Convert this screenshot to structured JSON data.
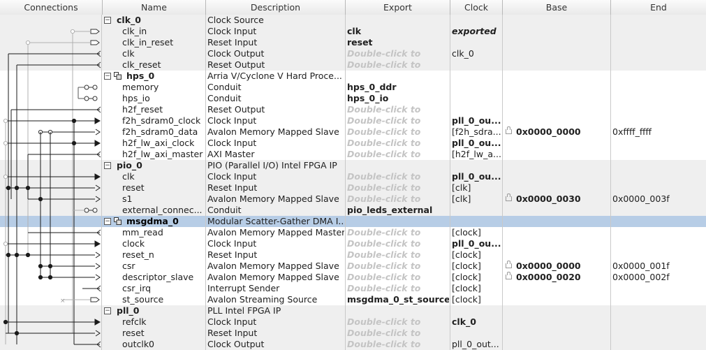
{
  "columns": [
    "Connections",
    "Name",
    "Description",
    "Export",
    "Clock",
    "Base",
    "End"
  ],
  "rows": [
    {
      "type": "component",
      "name": "clk_0",
      "desc": "Clock Source",
      "exp": "",
      "clk": "",
      "base": "",
      "end": ""
    },
    {
      "type": "port",
      "name": "clk_in",
      "desc": "Clock Input",
      "exp": "clk",
      "clk": "exported",
      "base": "",
      "end": ""
    },
    {
      "type": "port",
      "name": "clk_in_reset",
      "desc": "Reset Input",
      "exp": "reset",
      "clk": "",
      "base": "",
      "end": ""
    },
    {
      "type": "port",
      "name": "clk",
      "desc": "Clock Output",
      "exp": "Double-click to",
      "clk": "clk_0",
      "base": "",
      "end": ""
    },
    {
      "type": "port",
      "name": "clk_reset",
      "desc": "Reset Output",
      "exp": "Double-click to",
      "clk": "",
      "base": "",
      "end": ""
    },
    {
      "type": "component",
      "name": "hps_0",
      "desc": "Arria V/Cyclone V Hard Proce...",
      "exp": "",
      "clk": "",
      "base": "",
      "end": ""
    },
    {
      "type": "port",
      "name": "memory",
      "desc": "Conduit",
      "exp": "hps_0_ddr",
      "clk": "",
      "base": "",
      "end": ""
    },
    {
      "type": "port",
      "name": "hps_io",
      "desc": "Conduit",
      "exp": "hps_0_io",
      "clk": "",
      "base": "",
      "end": ""
    },
    {
      "type": "port",
      "name": "h2f_reset",
      "desc": "Reset Output",
      "exp": "Double-click to",
      "clk": "",
      "base": "",
      "end": ""
    },
    {
      "type": "port",
      "name": "f2h_sdram0_clock",
      "desc": "Clock Input",
      "exp": "Double-click to",
      "clk": "pll_0_ou...",
      "base": "",
      "end": ""
    },
    {
      "type": "port",
      "name": "f2h_sdram0_data",
      "desc": "Avalon Memory Mapped Slave",
      "exp": "Double-click to",
      "clk": "[f2h_sdra...",
      "base": "0x0000_0000",
      "end": "0xffff_ffff"
    },
    {
      "type": "port",
      "name": "h2f_lw_axi_clock",
      "desc": "Clock Input",
      "exp": "Double-click to",
      "clk": "pll_0_ou...",
      "base": "",
      "end": ""
    },
    {
      "type": "port",
      "name": "h2f_lw_axi_master",
      "desc": "AXI Master",
      "exp": "Double-click to",
      "clk": "[h2f_lw_a...",
      "base": "",
      "end": ""
    },
    {
      "type": "component",
      "name": "pio_0",
      "desc": "PIO (Parallel I/O) Intel FPGA IP",
      "exp": "",
      "clk": "",
      "base": "",
      "end": ""
    },
    {
      "type": "port",
      "name": "clk",
      "desc": "Clock Input",
      "exp": "Double-click to",
      "clk": "pll_0_ou...",
      "base": "",
      "end": ""
    },
    {
      "type": "port",
      "name": "reset",
      "desc": "Reset Input",
      "exp": "Double-click to",
      "clk": "[clk]",
      "base": "",
      "end": ""
    },
    {
      "type": "port",
      "name": "s1",
      "desc": "Avalon Memory Mapped Slave",
      "exp": "Double-click to",
      "clk": "[clk]",
      "base": "0x0000_0030",
      "end": "0x0000_003f"
    },
    {
      "type": "port",
      "name": "external_connec...",
      "desc": "Conduit",
      "exp": "pio_leds_external",
      "clk": "",
      "base": "",
      "end": ""
    },
    {
      "type": "component",
      "name": "msgdma_0",
      "desc": "Modular Scatter-Gather DMA I...",
      "exp": "",
      "clk": "",
      "base": "",
      "end": ""
    },
    {
      "type": "port",
      "name": "mm_read",
      "desc": "Avalon Memory Mapped Master",
      "exp": "Double-click to",
      "clk": "[clock]",
      "base": "",
      "end": ""
    },
    {
      "type": "port",
      "name": "clock",
      "desc": "Clock Input",
      "exp": "Double-click to",
      "clk": "pll_0_ou...",
      "base": "",
      "end": ""
    },
    {
      "type": "port",
      "name": "reset_n",
      "desc": "Reset Input",
      "exp": "Double-click to",
      "clk": "[clock]",
      "base": "",
      "end": ""
    },
    {
      "type": "port",
      "name": "csr",
      "desc": "Avalon Memory Mapped Slave",
      "exp": "Double-click to",
      "clk": "[clock]",
      "base": "0x0000_0000",
      "end": "0x0000_001f"
    },
    {
      "type": "port",
      "name": "descriptor_slave",
      "desc": "Avalon Memory Mapped Slave",
      "exp": "Double-click to",
      "clk": "[clock]",
      "base": "0x0000_0020",
      "end": "0x0000_002f"
    },
    {
      "type": "port",
      "name": "csr_irq",
      "desc": "Interrupt Sender",
      "exp": "Double-click to",
      "clk": "[clock]",
      "base": "",
      "end": ""
    },
    {
      "type": "port",
      "name": "st_source",
      "desc": "Avalon Streaming Source",
      "exp": "msgdma_0_st_source",
      "clk": "[clock]",
      "base": "",
      "end": ""
    },
    {
      "type": "component",
      "name": "pll_0",
      "desc": "PLL Intel FPGA IP",
      "exp": "",
      "clk": "",
      "base": "",
      "end": ""
    },
    {
      "type": "port",
      "name": "refclk",
      "desc": "Clock Input",
      "exp": "Double-click to",
      "clk": "clk_0",
      "base": "",
      "end": ""
    },
    {
      "type": "port",
      "name": "reset",
      "desc": "Reset Input",
      "exp": "Double-click to",
      "clk": "",
      "base": "",
      "end": ""
    },
    {
      "type": "port",
      "name": "outclk0",
      "desc": "Clock Output",
      "exp": "Double-click to",
      "clk": "pll_0_out...",
      "base": "",
      "end": ""
    }
  ],
  "selected_component": "msgdma_0",
  "colors": {
    "selected_row": "#b7cde6",
    "shaded_group": "#efefef",
    "placeholder": "#c4c4c4"
  }
}
